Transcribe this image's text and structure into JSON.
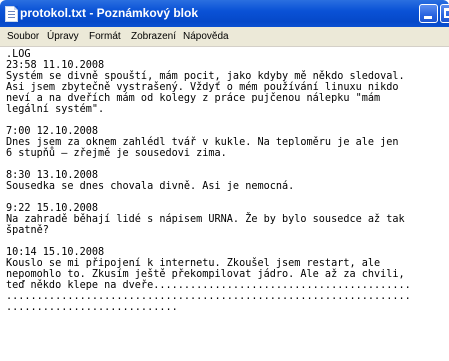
{
  "window": {
    "title": "protokol.txt - Poznámkový blok",
    "icon": "notepad-icon"
  },
  "menu": {
    "items": [
      "Soubor",
      "Úpravy",
      "Formát",
      "Zobrazení",
      "Nápověda"
    ]
  },
  "document": {
    "lines": [
      ".LOG",
      "23:58 11.10.2008",
      "Systém se divně spouští, mám pocit, jako kdyby mě někdo sledoval.",
      "Asi jsem zbytečně vystrašený. Vždyť o mém používání linuxu nikdo",
      "neví a na dveřích mám od kolegy z práce pujčenou nálepku \"mám",
      "legální systém\".",
      "",
      "7:00 12.10.2008",
      "Dnes jsem za oknem zahlédl tvář v kukle. Na teploměru je ale jen",
      "6 stupňů – zřejmě je sousedovi zima.",
      "",
      "8:30 13.10.2008",
      "Sousedka se dnes chovala divně. Asi je nemocná.",
      "",
      "9:22 15.10.2008",
      "Na zahradě běhají lidé s nápisem URNA. Že by bylo sousedce až tak",
      "špatně?",
      "",
      "10:14 15.10.2008",
      "Kouslo se mi připojení k internetu. Zkoušel jsem restart, ale",
      "nepomohlo to. Zkusím ještě překompilovat jádro. Ale až za chvili,",
      "teď někdo klepe na dveře..........................................",
      "..................................................................",
      "............................"
    ]
  }
}
